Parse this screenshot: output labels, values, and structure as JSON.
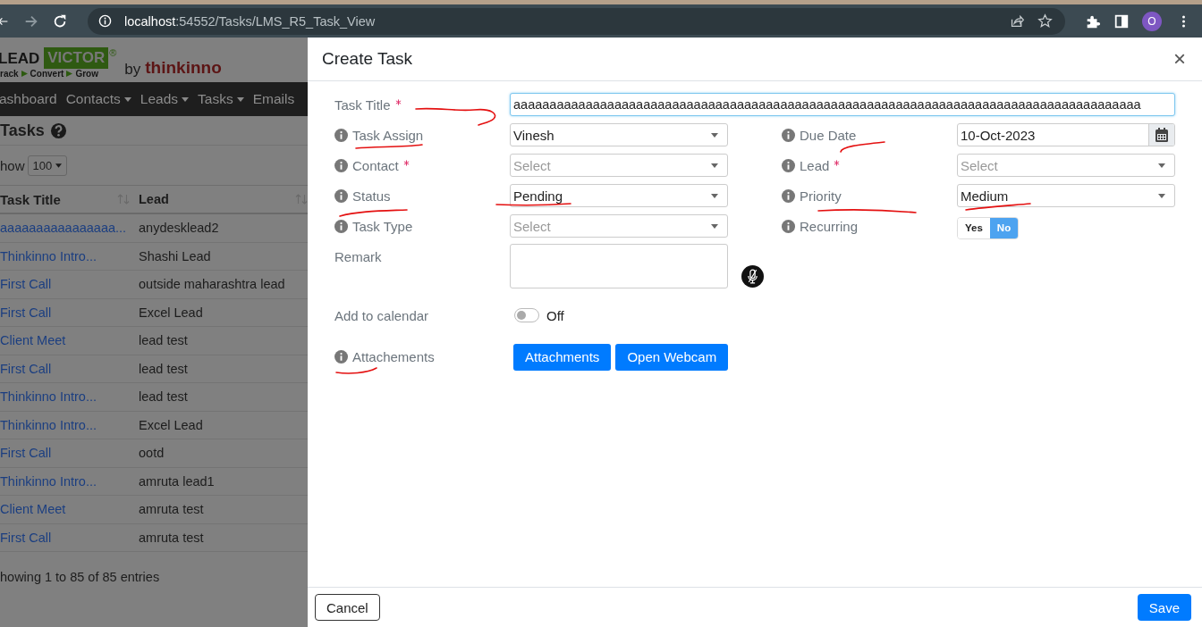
{
  "browser": {
    "url_host": "localhost",
    "url_path": ":54552/Tasks/LMS_R5_Task_View",
    "avatar": "O"
  },
  "page": {
    "logo": {
      "word1": "LEAD",
      "word2": "VICTOR",
      "mark": "®",
      "tagline": [
        "rack",
        "Convert",
        "Grow"
      ],
      "by": "by",
      "brand": "thinkinno"
    },
    "nav": [
      {
        "label": "ashboard",
        "dropdown": false
      },
      {
        "label": "Contacts",
        "dropdown": true
      },
      {
        "label": "Leads",
        "dropdown": true
      },
      {
        "label": "Tasks",
        "dropdown": true
      },
      {
        "label": "Emails",
        "dropdown": false
      }
    ],
    "title": "Tasks",
    "show_label": "how",
    "show_value": "100",
    "table": {
      "columns": [
        "Task Title",
        "Lead"
      ],
      "rows": [
        {
          "task_title": "aaaaaaaaaaaaaaaa...",
          "lead": "anydesklead2"
        },
        {
          "task_title": "Thinkinno Intro...",
          "lead": "Shashi Lead"
        },
        {
          "task_title": "First Call",
          "lead": "outside maharashtra lead"
        },
        {
          "task_title": "First Call",
          "lead": "Excel Lead"
        },
        {
          "task_title": "Client Meet",
          "lead": "lead test"
        },
        {
          "task_title": "First Call",
          "lead": "lead test"
        },
        {
          "task_title": "Thinkinno Intro...",
          "lead": "lead test"
        },
        {
          "task_title": "Thinkinno Intro...",
          "lead": "Excel Lead"
        },
        {
          "task_title": "First Call",
          "lead": "ootd"
        },
        {
          "task_title": "Thinkinno Intro...",
          "lead": "amruta lead1"
        },
        {
          "task_title": "Client Meet",
          "lead": "amruta test"
        },
        {
          "task_title": "First Call",
          "lead": "amruta test"
        }
      ]
    },
    "info": "howing 1 to 85 of 85 entries"
  },
  "modal": {
    "title": "Create Task",
    "close": "×",
    "rows": [
      [
        {
          "kind": "text",
          "label": "Task Title",
          "info": false,
          "required": true,
          "value": "aaaaaaaaaaaaaaaaaaaaaaaaaaaaaaaaaaaaaaaaaaaaaaaaaaaaaaaaaaaaaaaaaaaaaaaaaaaaaaaaaaaaaaa"
        }
      ],
      [
        {
          "kind": "select",
          "label": "Task Assign",
          "info": true,
          "required": false,
          "value": "Vinesh"
        },
        {
          "kind": "date",
          "label": "Due Date",
          "info": true,
          "required": false,
          "value": "10-Oct-2023"
        }
      ],
      [
        {
          "kind": "select",
          "label": "Contact",
          "info": true,
          "required": true,
          "placeholder": "Select"
        },
        {
          "kind": "select",
          "label": "Lead",
          "info": true,
          "required": true,
          "placeholder": "Select"
        }
      ],
      [
        {
          "kind": "select",
          "label": "Status",
          "info": true,
          "required": false,
          "value": "Pending"
        },
        {
          "kind": "select",
          "label": "Priority",
          "info": true,
          "required": false,
          "value": "Medium"
        }
      ],
      [
        {
          "kind": "select",
          "label": "Task Type",
          "info": true,
          "required": false,
          "placeholder": "Select"
        },
        {
          "kind": "yesno",
          "label": "Recurring",
          "info": true,
          "required": false,
          "options": [
            {
              "label": "Yes",
              "selected": false
            },
            {
              "label": "No",
              "selected": true
            }
          ]
        }
      ],
      [
        {
          "kind": "textarea",
          "label": "Remark",
          "info": false,
          "required": false
        }
      ],
      [
        {
          "kind": "switch",
          "label": "Add to calendar",
          "info": false,
          "required": false,
          "on": false,
          "state_label": "Off"
        }
      ],
      [
        {
          "kind": "buttons",
          "label": "Attachements",
          "info": true,
          "required": false,
          "buttons": [
            "Attachments",
            "Open Webcam"
          ]
        }
      ]
    ],
    "footer": {
      "cancel": "Cancel",
      "save": "Save"
    }
  }
}
